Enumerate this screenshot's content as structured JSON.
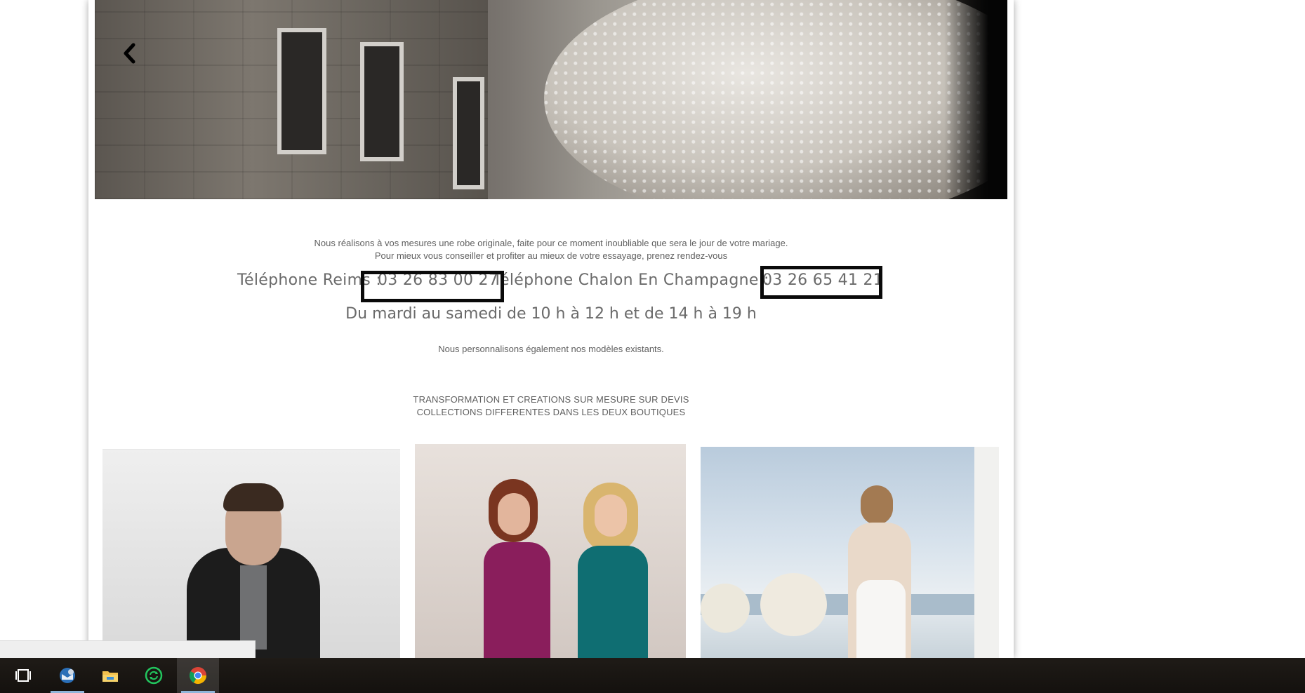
{
  "hero": {
    "prev_icon": "chevron-left-icon"
  },
  "content": {
    "intro_line1": "Nous réalisons à vos mesures une robe originale, faite pour ce moment inoubliable que sera le jour de votre mariage.",
    "intro_line2": "Pour mieux vous conseiller et profiter au mieux de votre essayage, prenez rendez-vous",
    "phone_reims_label": "Téléphone Reims : ",
    "phone_reims_number": "03 26 83 00 27",
    "phone_chalon_label": " Téléphone Chalon En Champagne : ",
    "phone_chalon_number": "03 26 65 41 21",
    "hours": "Du mardi au samedi de 10 h à 12 h et de 14 h à 19 h",
    "personnalisation": "Nous personnalisons également nos modèles existants.",
    "caps_line1": "TRANSFORMATION ET CREATIONS SUR MESURE SUR DEVIS",
    "caps_line2": "COLLECTIONS DIFFERENTES DANS LES DEUX BOUTIQUES"
  },
  "taskbar": {
    "items": [
      {
        "icon": "task-view-icon",
        "active": false
      },
      {
        "icon": "mail-app-icon",
        "active": false
      },
      {
        "icon": "file-explorer-icon",
        "active": false
      },
      {
        "icon": "sync-app-icon",
        "active": false
      },
      {
        "icon": "chrome-icon",
        "active": true
      }
    ],
    "accent": "#8fb5d9"
  },
  "colors": {
    "text": "#5f5f5f",
    "highlight_box": "#0a0a0a"
  }
}
